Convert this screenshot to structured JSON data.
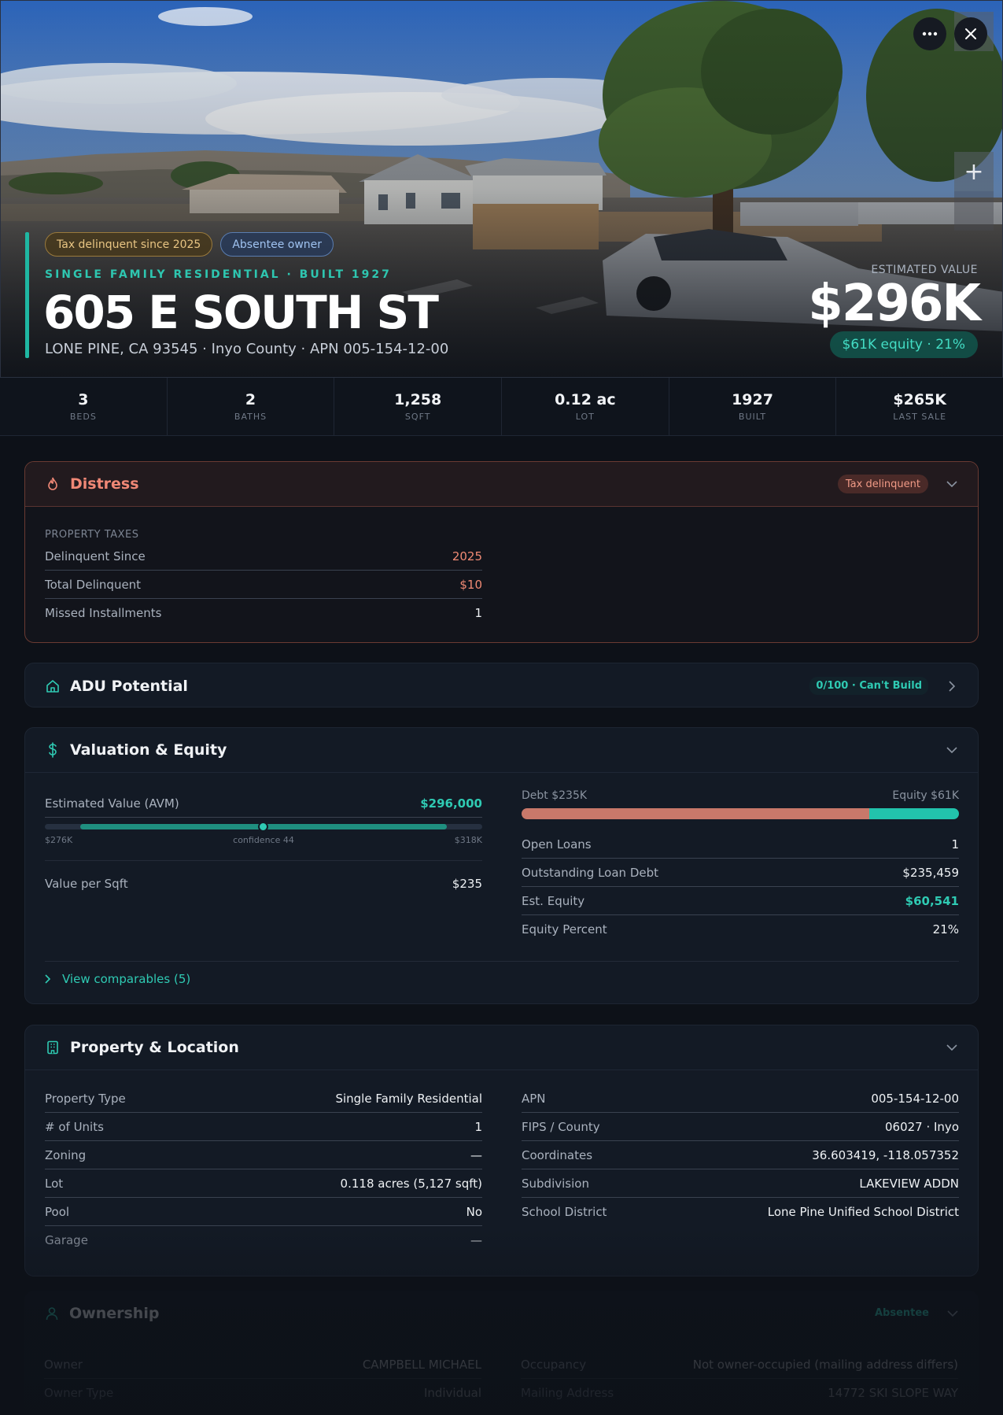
{
  "hero": {
    "chips": [
      "Tax delinquent since 2025",
      "Absentee owner"
    ],
    "subtitle": "SINGLE FAMILY RESIDENTIAL · BUILT 1927",
    "title": "605 E SOUTH ST",
    "address": "LONE PINE, CA 93545 · Inyo County · APN 005-154-12-00",
    "estimated_label": "ESTIMATED VALUE",
    "estimated_value": "$296K",
    "equity_badge": "$61K equity · 21%",
    "zoom_label": "+"
  },
  "stats": [
    {
      "value": "3",
      "label": "BEDS"
    },
    {
      "value": "2",
      "label": "BATHS"
    },
    {
      "value": "1,258",
      "label": "SQFT"
    },
    {
      "value": "0.12 ac",
      "label": "LOT"
    },
    {
      "value": "1927",
      "label": "BUILT"
    },
    {
      "value": "$265K",
      "label": "LAST SALE"
    }
  ],
  "distress": {
    "title": "Distress",
    "tag": "Tax delinquent",
    "section": "PROPERTY TAXES",
    "rows": [
      {
        "k": "Delinquent Since",
        "v": "2025"
      },
      {
        "k": "Total Delinquent",
        "v": "$10"
      },
      {
        "k": "Missed Installments",
        "v": "1"
      }
    ]
  },
  "adu": {
    "title": "ADU Potential",
    "tag": "0/100 · Can't Build"
  },
  "valuation": {
    "title": "Valuation & Equity",
    "avm_label": "Estimated Value (AVM)",
    "avm_value": "$296,000",
    "range_low": "$276K",
    "range_high": "$318K",
    "confidence": "confidence 44",
    "value_sqft_label": "Value per Sqft",
    "value_sqft": "$235",
    "debt_label": "Debt $235K",
    "equity_label": "Equity $61K",
    "debt_fraction": 0.795,
    "rows": [
      {
        "k": "Open Loans",
        "v": "1"
      },
      {
        "k": "Outstanding Loan Debt",
        "v": "$235,459"
      },
      {
        "k": "Est. Equity",
        "v": "$60,541"
      },
      {
        "k": "Equity Percent",
        "v": "21%"
      }
    ],
    "comparables_link": "View comparables (5)"
  },
  "property": {
    "title": "Property & Location",
    "left": [
      {
        "k": "Property Type",
        "v": "Single Family Residential"
      },
      {
        "k": "# of Units",
        "v": "1"
      },
      {
        "k": "Zoning",
        "v": "—"
      },
      {
        "k": "Lot",
        "v": "0.118 acres (5,127 sqft)"
      },
      {
        "k": "Pool",
        "v": "No"
      },
      {
        "k": "Garage",
        "v": "—"
      }
    ],
    "right": [
      {
        "k": "APN",
        "v": "005-154-12-00"
      },
      {
        "k": "FIPS / County",
        "v": "06027 · Inyo"
      },
      {
        "k": "Coordinates",
        "v": "36.603419, -118.057352"
      },
      {
        "k": "Subdivision",
        "v": "LAKEVIEW ADDN"
      },
      {
        "k": "School District",
        "v": "Lone Pine Unified School District"
      }
    ]
  },
  "ownership": {
    "title": "Ownership",
    "tag": "Absentee",
    "left": [
      {
        "k": "Owner",
        "v": "CAMPBELL MICHAEL"
      },
      {
        "k": "Owner Type",
        "v": "Individual"
      }
    ],
    "right": [
      {
        "k": "Occupancy",
        "v": "Not owner-occupied (mailing address differs)"
      },
      {
        "k": "Mailing Address",
        "v": "14772 SKI SLOPE WAY"
      }
    ]
  },
  "colors": {
    "accent": "#1fb7a2",
    "danger": "#f08876",
    "debt_bar": "#c8786a",
    "equity_bar": "#22c3ac"
  }
}
